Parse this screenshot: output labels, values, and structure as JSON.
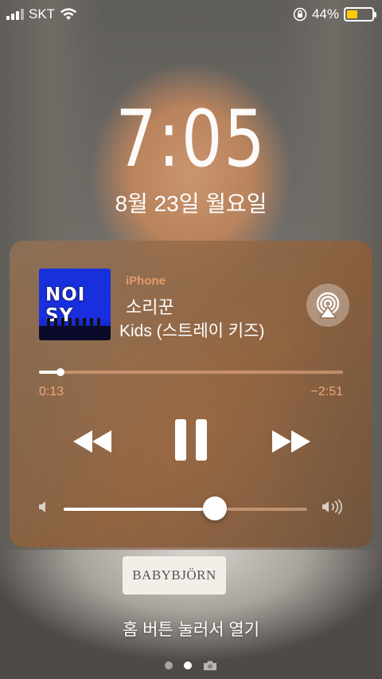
{
  "status_bar": {
    "carrier": "SKT",
    "battery_percent": "44%",
    "battery_level": 0.44,
    "icons": [
      "signal-icon",
      "wifi-icon",
      "orientation-lock-icon",
      "battery-icon"
    ]
  },
  "lock_screen": {
    "time": "7:05",
    "date": "8월 23일 월요일",
    "unlock_hint": "홈 버튼 눌러서 열기",
    "pages": 2,
    "active_page": 1
  },
  "now_playing": {
    "source": "iPhone",
    "title": "소리꾼",
    "artist": "Kids (스트레이 키즈)",
    "album_art_text": "NOI SY",
    "elapsed": "0:13",
    "remaining": "−2:51",
    "progress": 0.07,
    "volume": 0.62,
    "accent_color": "#f0a878",
    "controls": [
      "rewind-icon",
      "pause-icon",
      "fast-forward-icon",
      "airplay-icon"
    ]
  },
  "wallpaper": {
    "label_text": "BABYBJÖRN"
  }
}
